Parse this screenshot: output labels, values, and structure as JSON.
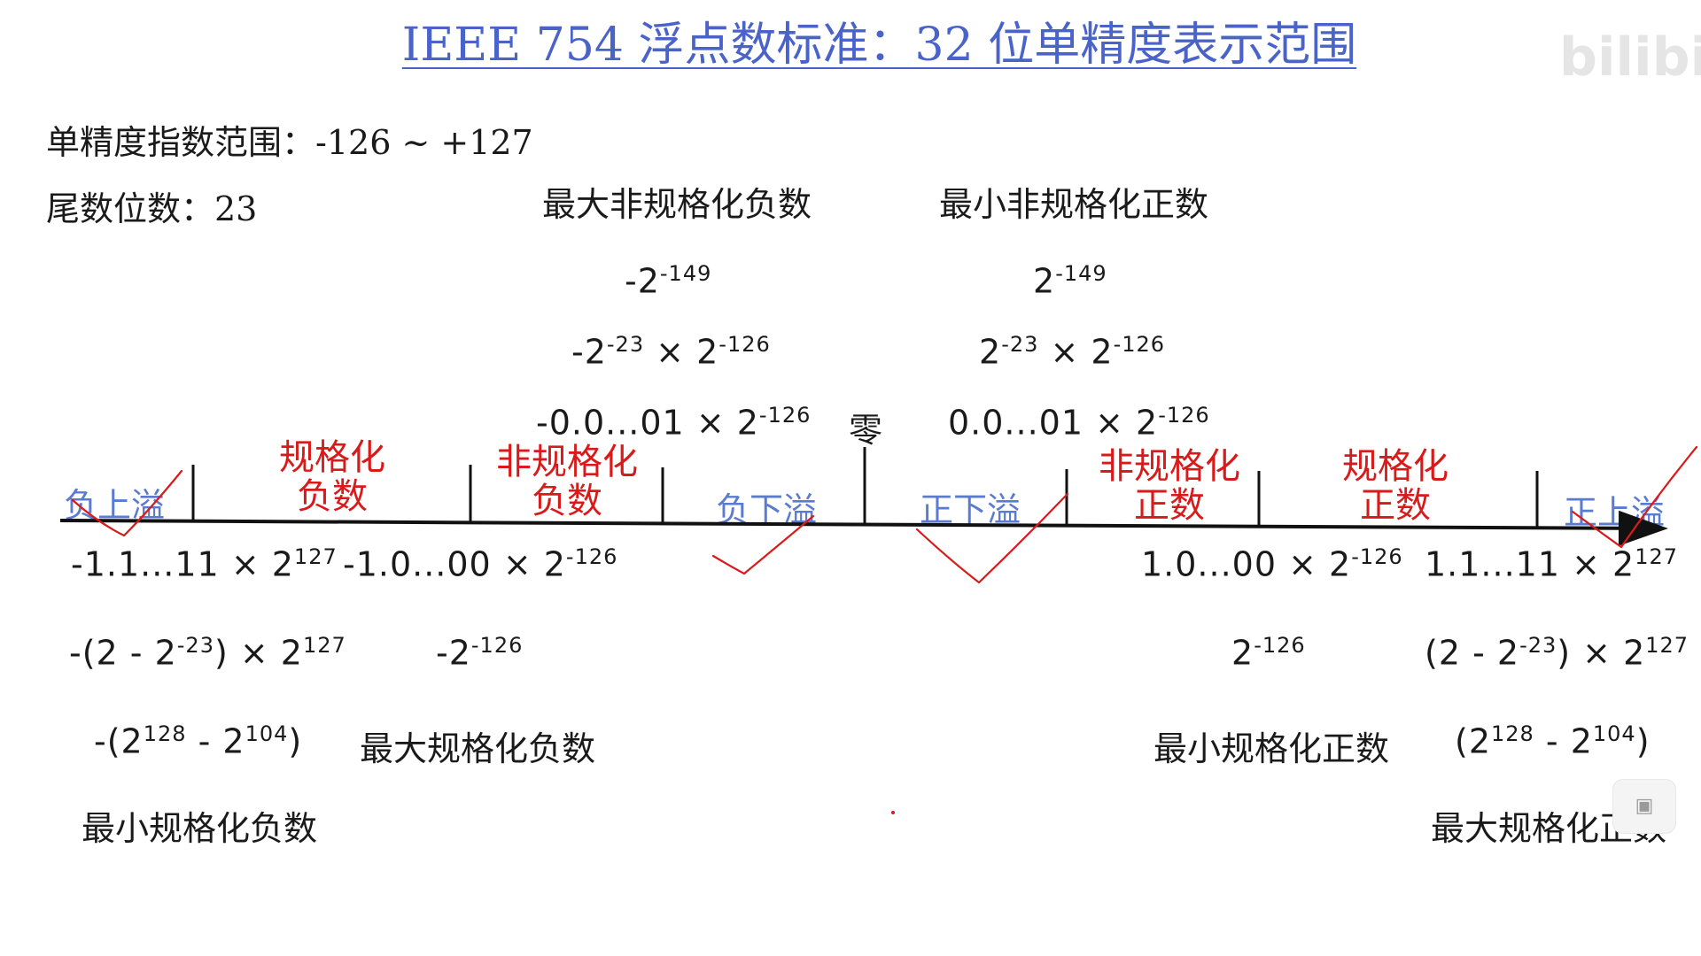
{
  "title": "IEEE 754 浮点数标准：32 位单精度表示范围",
  "info": {
    "exponent_range": "单精度指数范围：-126 ~ +127",
    "mantissa_bits": "尾数位数：23"
  },
  "headings": {
    "max_denorm_neg": "最大非规格化负数",
    "min_denorm_pos": "最小非规格化正数",
    "max_norm_neg": "最大规格化负数",
    "min_norm_pos": "最小规格化正数",
    "min_norm_neg": "最小规格化负数",
    "max_norm_pos": "最大规格化正数"
  },
  "expressions": {
    "neg_2_149": {
      "base": "-2",
      "exp": "-149"
    },
    "pos_2_149": {
      "base": "2",
      "exp": "-149"
    },
    "neg_2_23_x_2_126": {
      "b1": "-2",
      "e1": "-23",
      "op": " × ",
      "b2": "2",
      "e2": "-126"
    },
    "pos_2_23_x_2_126": {
      "b1": "2",
      "e1": "-23",
      "op": " × ",
      "b2": "2",
      "e2": "-126"
    },
    "neg_0_01": {
      "b1": "-0.0...01 × 2",
      "e1": "-126"
    },
    "pos_0_01": {
      "b1": "0.0...01 × 2",
      "e1": "-126"
    },
    "neg_1_11": {
      "b1": "-1.1...11 × 2",
      "e1": "127"
    },
    "neg_1_00": {
      "b1": "-1.0...00 × 2",
      "e1": "-126"
    },
    "pos_1_00": {
      "b1": "1.0...00 × 2",
      "e1": "-126"
    },
    "pos_1_11": {
      "b1": "1.1...11 × 2",
      "e1": "127"
    },
    "neg_2m2_23": {
      "a": "-(2 - 2",
      "ae": "-23",
      "b": ") × 2",
      "be": "127"
    },
    "pos_2m2_23": {
      "a": "(2 - 2",
      "ae": "-23",
      "b": ") × 2",
      "be": "127"
    },
    "neg_2_126": {
      "base": "-2",
      "exp": "-126"
    },
    "pos_2_126": {
      "base": "2",
      "exp": "-126"
    },
    "neg_2128": {
      "a": "-(2",
      "ae": "128",
      "b": " - 2",
      "be": "104",
      "c": ")"
    },
    "pos_2128": {
      "a": "(2",
      "ae": "128",
      "b": " - 2",
      "be": "104",
      "c": ")"
    }
  },
  "zero_label": "零",
  "regions": {
    "neg_overflow": "负上溢",
    "norm_neg_l1": "规格化",
    "norm_neg_l2": "负数",
    "denorm_neg_l1": "非规格化",
    "denorm_neg_l2": "负数",
    "neg_underflow": "负下溢",
    "pos_underflow": "正下溢",
    "denorm_pos_l1": "非规格化",
    "denorm_pos_l2": "正数",
    "norm_pos_l1": "规格化",
    "norm_pos_l2": "正数",
    "pos_overflow": "正上溢"
  },
  "watermark": "bilibili",
  "colors": {
    "title": "#4a63c8",
    "region_red": "#d91a1a",
    "region_blue": "#5a7bd0",
    "checkmark": "#d91a1a"
  }
}
